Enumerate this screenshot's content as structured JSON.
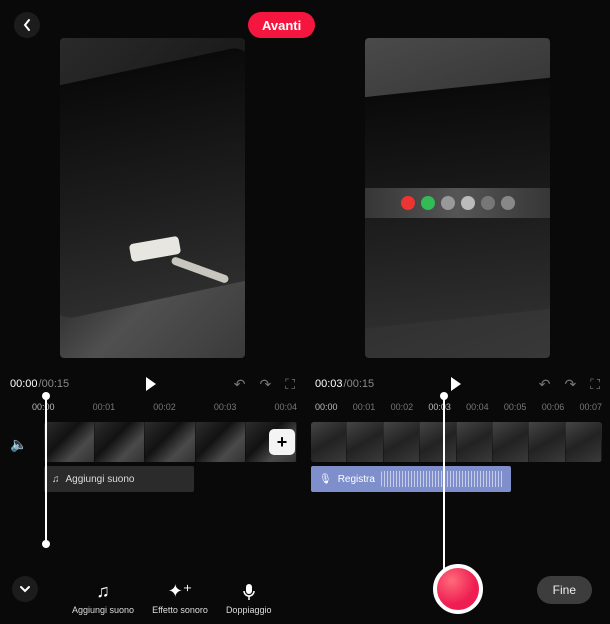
{
  "colors": {
    "accent": "#F4163E",
    "record": "#ee1d52",
    "audioTrack": "#7e8fcb"
  },
  "header": {
    "back_icon": "chevron-left",
    "next_label": "Avanti"
  },
  "panes": [
    {
      "currentTime": "00:00",
      "totalTime": "/00:15",
      "ticks": [
        "00:00",
        "00:01",
        "00:02",
        "00:03",
        "00:04"
      ],
      "audio": {
        "icon": "music-note",
        "label": "Aggiungi suono"
      },
      "tools": [
        {
          "icon": "music-note",
          "label": "Aggiungi\nsuono"
        },
        {
          "icon": "sparkle",
          "label": "Effetto\nsonoro"
        },
        {
          "icon": "mic",
          "label": "Doppiaggio"
        }
      ]
    },
    {
      "currentTime": "00:03",
      "totalTime": "/00:15",
      "ticks": [
        "00:00",
        "00:01",
        "00:02",
        "00:03",
        "00:04",
        "00:05",
        "00:06",
        "00:07"
      ],
      "audio": {
        "icon": "mic",
        "label": "Registra"
      },
      "fine_label": "Fine"
    }
  ]
}
